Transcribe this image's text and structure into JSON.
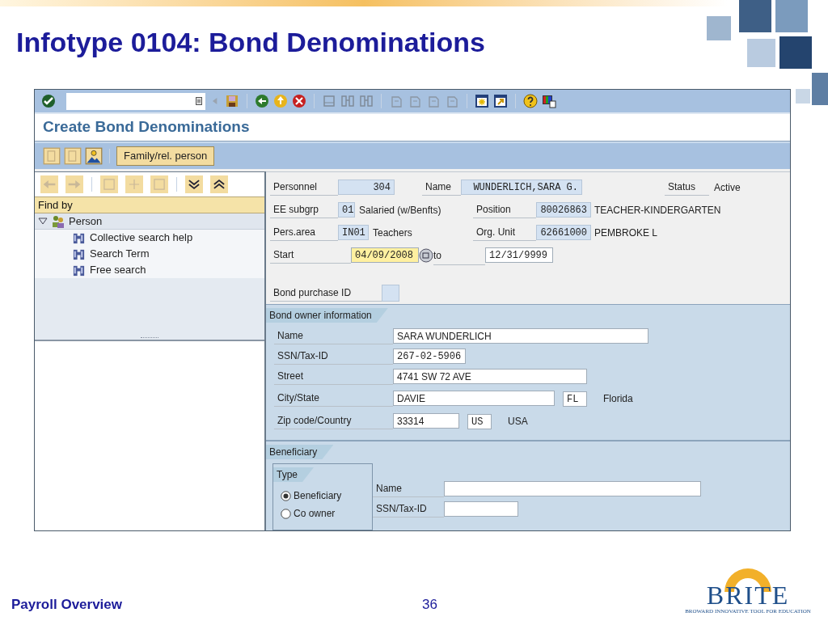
{
  "slide": {
    "title": "Infotype 0104: Bond Denominations",
    "footer": "Payroll Overview",
    "page_number": "36",
    "logo": {
      "name": "BRITE",
      "tagline": "BROWARD INNOVATIVE TOOL FOR EDUCATION"
    }
  },
  "window": {
    "title": "Create Bond Denominations",
    "app_toolbar": [
      {
        "label": "Family/rel. person"
      }
    ]
  },
  "navigator": {
    "header": "Find by",
    "tree": [
      {
        "label": "Person",
        "expanded": true,
        "children": [
          {
            "label": "Collective search help"
          },
          {
            "label": "Search Term"
          },
          {
            "label": "Free search"
          }
        ]
      }
    ]
  },
  "header": {
    "personnel": {
      "label": "Personnel",
      "value": "304"
    },
    "name": {
      "label": "Name",
      "value": "WUNDERLICH,SARA G."
    },
    "status": {
      "label": "Status",
      "value": "Active"
    },
    "ee_subgroup": {
      "label": "EE subgrp",
      "value": "01",
      "text": "Salaried (w/Benfts)"
    },
    "position": {
      "label": "Position",
      "value": "80026863",
      "text": "TEACHER-KINDERGARTEN"
    },
    "pers_area": {
      "label": "Pers.area",
      "value": "IN01",
      "text": "Teachers"
    },
    "org_unit": {
      "label": "Org. Unit",
      "value": "62661000",
      "text": "PEMBROKE L"
    },
    "start": {
      "label": "Start",
      "value": "04/09/2008",
      "focused": true
    },
    "end": {
      "label": "to",
      "value": "12/31/9999"
    },
    "bond_purchase_id": {
      "label": "Bond purchase ID"
    }
  },
  "bond_owner": {
    "title": "Bond owner information",
    "fields": [
      {
        "label": "Name",
        "value": "SARA WUNDERLICH"
      },
      {
        "label": "SSN/Tax-ID",
        "value": "267-02-5906"
      },
      {
        "label": "Street",
        "value": "4741 SW 72 AVE"
      },
      {
        "label": "City/State",
        "value": "DAVIE",
        "code": "FL",
        "description": "Florida"
      },
      {
        "label": "Zip code/Country",
        "value": "33314",
        "code": "US",
        "description": "USA"
      }
    ]
  },
  "beneficiary": {
    "title": "Beneficiary",
    "type_group": {
      "title": "Type",
      "options": [
        {
          "label": "Beneficiary",
          "selected": true
        },
        {
          "label": "Co owner",
          "selected": false
        }
      ]
    },
    "fields": [
      {
        "label": "Name"
      },
      {
        "label": "SSN/Tax-ID"
      }
    ]
  }
}
